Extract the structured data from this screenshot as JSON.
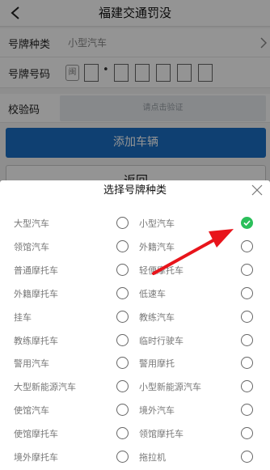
{
  "nav": {
    "title": "福建交通罚没",
    "back_icon": "back-chevron-icon"
  },
  "form": {
    "plate_type_label": "号牌种类",
    "plate_type_value": "小型汽车",
    "plate_number_label": "号牌号码",
    "plate_prefix": "闽",
    "plate_separator": "•",
    "verify_label": "校验码",
    "verify_placeholder": "请点击验证"
  },
  "buttons": {
    "add": "添加车辆",
    "return": "返回"
  },
  "sheet": {
    "title": "选择号牌种类",
    "close_icon": "close-icon",
    "options": [
      {
        "label": "大型汽车",
        "selected": false
      },
      {
        "label": "小型汽车",
        "selected": true
      },
      {
        "label": "领馆汽车",
        "selected": false
      },
      {
        "label": "外籍汽车",
        "selected": false
      },
      {
        "label": "普通摩托车",
        "selected": false
      },
      {
        "label": "轻便摩托车",
        "selected": false
      },
      {
        "label": "外籍摩托车",
        "selected": false
      },
      {
        "label": "低速车",
        "selected": false
      },
      {
        "label": "挂车",
        "selected": false
      },
      {
        "label": "教练汽车",
        "selected": false
      },
      {
        "label": "教练摩托车",
        "selected": false
      },
      {
        "label": "临时行驶车",
        "selected": false
      },
      {
        "label": "警用汽车",
        "selected": false
      },
      {
        "label": "警用摩托",
        "selected": false
      },
      {
        "label": "大型新能源汽车",
        "selected": false
      },
      {
        "label": "小型新能源汽车",
        "selected": false
      },
      {
        "label": "使馆汽车",
        "selected": false
      },
      {
        "label": "境外汽车",
        "selected": false
      },
      {
        "label": "使馆摩托车",
        "selected": false
      },
      {
        "label": "领馆摩托车",
        "selected": false
      },
      {
        "label": "境外摩托车",
        "selected": false
      },
      {
        "label": "拖拉机",
        "selected": false
      }
    ]
  },
  "colors": {
    "primary": "#1a6fc4",
    "selected": "#2bbf5a",
    "annotation_arrow": "#e8141b"
  }
}
